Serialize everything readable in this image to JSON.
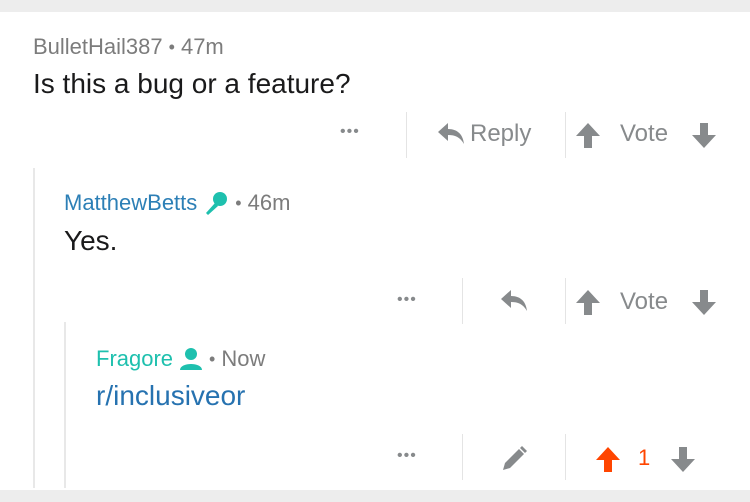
{
  "comments": [
    {
      "author": "BulletHail387",
      "separator": "•",
      "age": "47m",
      "body": "Is this a bug or a feature?",
      "more_label": "•••",
      "reply_label": "Reply",
      "vote_label": "Vote"
    },
    {
      "author": "MatthewBetts",
      "author_badge": "microphone-icon",
      "separator": "•",
      "age": "46m",
      "body": "Yes.",
      "more_label": "•••",
      "vote_label": "Vote"
    },
    {
      "author": "Fragore",
      "author_badge": "user-icon",
      "separator": "•",
      "age": "Now",
      "body": "r/inclusiveor",
      "more_label": "•••",
      "vote_count": "1"
    }
  ],
  "colors": {
    "meta": "#7c7c7c",
    "text": "#1a1a1b",
    "icon": "#878a8c",
    "upvote_active": "#ff4500",
    "mod_name": "#2c7fb6",
    "op_name": "#1ec0ae",
    "link": "#2672b0"
  }
}
